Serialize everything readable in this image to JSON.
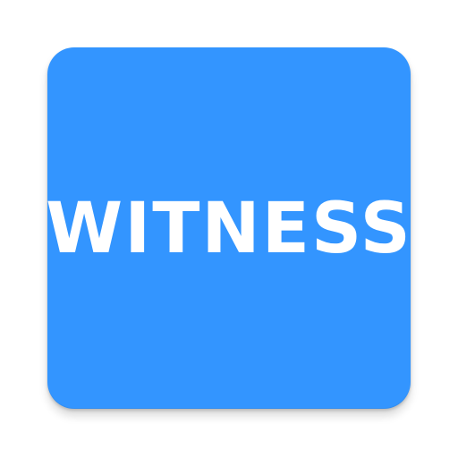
{
  "icon": {
    "wordmark": "WITNESS",
    "background_color": "#3395FF",
    "text_color": "#FFFFFF"
  }
}
